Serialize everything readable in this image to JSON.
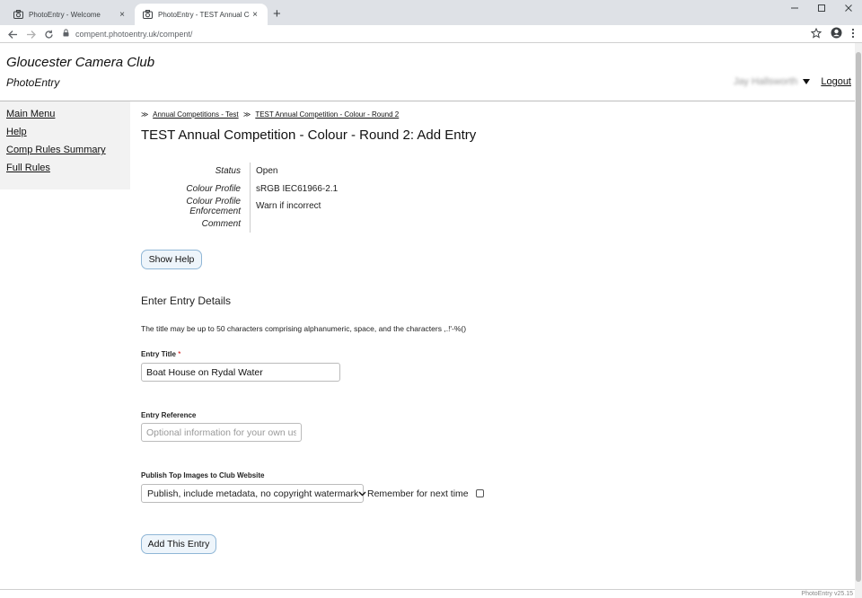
{
  "browser": {
    "tabs": [
      {
        "title": "PhotoEntry - Welcome",
        "icon": "camera-icon"
      },
      {
        "title": "PhotoEntry - TEST Annual Comp",
        "icon": "camera-icon"
      }
    ],
    "close_glyph": "×",
    "new_tab_glyph": "+",
    "url": "compent.photoentry.uk/compent/"
  },
  "header": {
    "site_title": "Gloucester Camera Club",
    "site_subtitle": "PhotoEntry",
    "user_name": "Jay Hallsworth",
    "logout_label": "Logout"
  },
  "sidebar": {
    "items": [
      {
        "label": "Main Menu"
      },
      {
        "label": "Help"
      },
      {
        "label": "Comp Rules Summary"
      },
      {
        "label": "Full Rules"
      }
    ]
  },
  "main": {
    "breadcrumb": [
      "Annual Competitions - Test",
      "TEST Annual Competition - Colour - Round 2"
    ],
    "breadcrumb_sep": "≫",
    "heading": "TEST Annual Competition - Colour - Round 2: Add Entry",
    "info": [
      {
        "label": "Status",
        "value": "Open"
      },
      {
        "label": "Colour Profile",
        "value": "sRGB IEC61966-2.1"
      },
      {
        "label": "Colour Profile Enforcement",
        "value": "Warn if incorrect"
      },
      {
        "label": "Comment",
        "value": ""
      }
    ],
    "show_help_label": "Show Help",
    "section_heading": "Enter Entry Details",
    "title_hint": "The title may be up to 50 characters comprising alphanumeric, space, and the characters ,.!'-%()",
    "entry_title_label": "Entry Title",
    "required_marker": "*",
    "entry_title_value": "Boat House on Rydal Water",
    "entry_ref_label": "Entry Reference",
    "entry_ref_placeholder": "Optional information for your own use",
    "publish_label": "Publish Top Images to Club Website",
    "publish_selected": "Publish, include metadata, no copyright watermark",
    "remember_label": "Remember for next time",
    "add_entry_label": "Add This Entry"
  },
  "footer": {
    "version_text": "PhotoEntry v25.15"
  }
}
